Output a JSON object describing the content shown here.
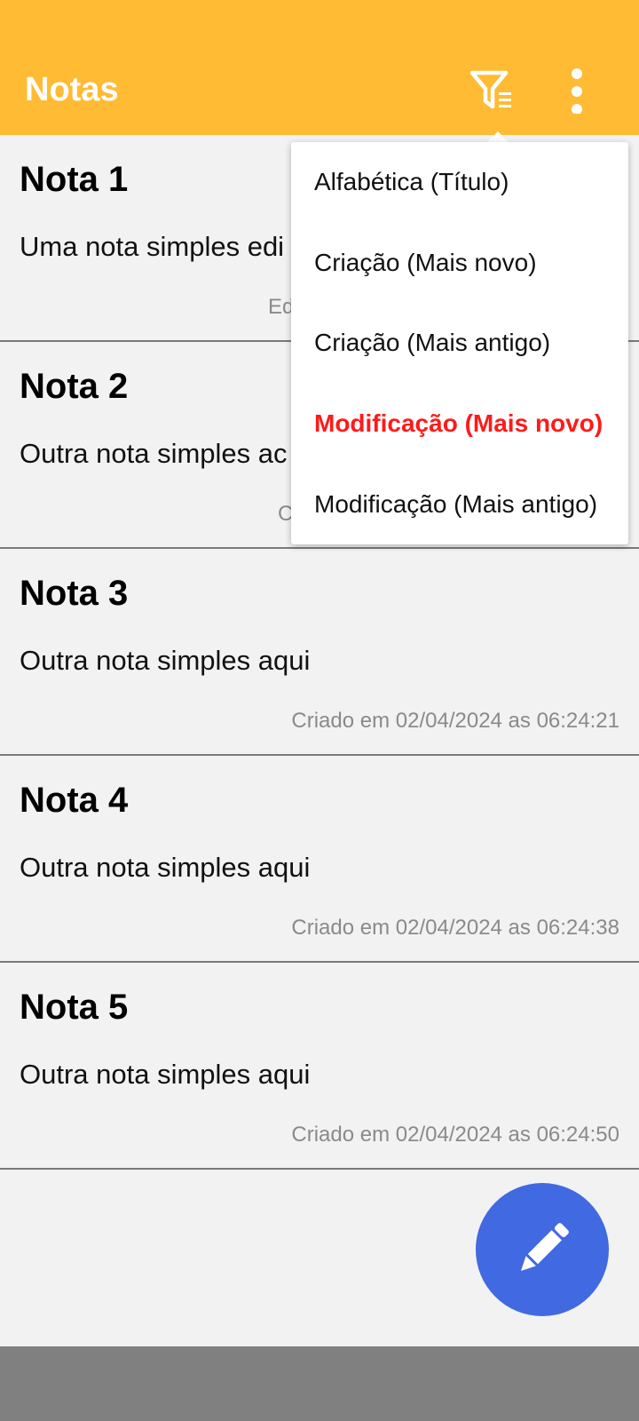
{
  "appbar": {
    "title": "Notas",
    "filter_icon": "filter-list-icon",
    "more_icon": "more-vertical-icon"
  },
  "notes": [
    {
      "title": "Nota 1",
      "body": "Uma nota simples edi",
      "date": "Ed"
    },
    {
      "title": "Nota 2",
      "body": "Outra nota simples ac",
      "date": "C"
    },
    {
      "title": "Nota 3",
      "body": "Outra nota simples aqui",
      "date": "Criado em 02/04/2024 as 06:24:21"
    },
    {
      "title": "Nota 4",
      "body": "Outra nota simples aqui",
      "date": "Criado em 02/04/2024 as 06:24:38"
    },
    {
      "title": "Nota 5",
      "body": "Outra nota simples aqui",
      "date": "Criado em 02/04/2024 as 06:24:50"
    }
  ],
  "sort_menu": {
    "items": [
      {
        "label": "Alfabética (Título)",
        "selected": false
      },
      {
        "label": "Criação (Mais novo)",
        "selected": false
      },
      {
        "label": "Criação (Mais antigo)",
        "selected": false
      },
      {
        "label": "Modificação (Mais novo)",
        "selected": true
      },
      {
        "label": "Modificação (Mais antigo)",
        "selected": false
      }
    ]
  },
  "fab": {
    "icon": "pencil-icon"
  },
  "colors": {
    "appbar": "#ffbb33",
    "fab": "#4169e1",
    "selected": "#ff1a1a",
    "background": "#f2f2f2",
    "navbar": "#808080"
  }
}
